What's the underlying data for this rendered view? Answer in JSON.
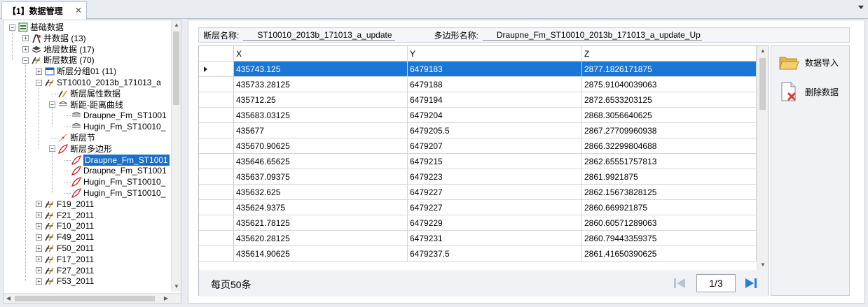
{
  "tab": {
    "title": "【1】数据管理",
    "close": "✕"
  },
  "tree": {
    "items": [
      {
        "label": "基础数据",
        "icon": "database-icon",
        "level": 0,
        "exp": "−"
      },
      {
        "label": "井数据 (13)",
        "icon": "well-icon",
        "level": 1,
        "exp": "+"
      },
      {
        "label": "地层数据 (17)",
        "icon": "layers-icon",
        "level": 1,
        "exp": "+"
      },
      {
        "label": "断层数据 (70)",
        "icon": "fault-icon",
        "level": 1,
        "exp": "−"
      },
      {
        "label": "断层分组01 (11)",
        "icon": "group-icon",
        "level": 2,
        "exp": "+"
      },
      {
        "label": "ST10010_2013b_171013_a",
        "icon": "fault-icon",
        "level": 2,
        "exp": "−"
      },
      {
        "label": "断层属性数据",
        "icon": "fault-attr-icon",
        "level": 3,
        "exp": ""
      },
      {
        "label": "断距-距离曲线",
        "icon": "curve-icon",
        "level": 3,
        "exp": "−"
      },
      {
        "label": "Draupne_Fm_ST1001",
        "icon": "curve-icon",
        "level": 4,
        "exp": ""
      },
      {
        "label": "Hugin_Fm_ST10010_",
        "icon": "curve-icon",
        "level": 4,
        "exp": ""
      },
      {
        "label": "断层节",
        "icon": "fault-node-icon",
        "level": 3,
        "exp": ""
      },
      {
        "label": "断层多边形",
        "icon": "polygon-icon",
        "level": 3,
        "exp": "−"
      },
      {
        "label": "Draupne_Fm_ST1001",
        "icon": "polygon-icon",
        "level": 4,
        "exp": "",
        "selected": true
      },
      {
        "label": "Draupne_Fm_ST1001",
        "icon": "polygon-icon",
        "level": 4,
        "exp": ""
      },
      {
        "label": "Hugin_Fm_ST10010_",
        "icon": "polygon-icon",
        "level": 4,
        "exp": ""
      },
      {
        "label": "Hugin_Fm_ST10010_",
        "icon": "polygon-icon",
        "level": 4,
        "exp": ""
      },
      {
        "label": "F19_2011",
        "icon": "fault-icon",
        "level": 2,
        "exp": "+"
      },
      {
        "label": "F21_2011",
        "icon": "fault-icon",
        "level": 2,
        "exp": "+"
      },
      {
        "label": "F10_2011",
        "icon": "fault-icon",
        "level": 2,
        "exp": "+"
      },
      {
        "label": "F49_2011",
        "icon": "fault-icon",
        "level": 2,
        "exp": "+"
      },
      {
        "label": "F50_2011",
        "icon": "fault-icon",
        "level": 2,
        "exp": "+"
      },
      {
        "label": "F17_2011",
        "icon": "fault-icon",
        "level": 2,
        "exp": "+"
      },
      {
        "label": "F27_2011",
        "icon": "fault-icon",
        "level": 2,
        "exp": "+"
      },
      {
        "label": "F53_2011",
        "icon": "fault-icon",
        "level": 2,
        "exp": "+"
      }
    ]
  },
  "info": {
    "fault_label": "断层名称:",
    "fault_value": "ST10010_2013b_171013_a_update",
    "polygon_label": "多边形名称:",
    "polygon_value": "Draupne_Fm_ST10010_2013b_171013_a_update_Up"
  },
  "grid": {
    "columns": [
      "X",
      "Y",
      "Z"
    ],
    "rows": [
      [
        "435743.125",
        "6479183",
        "2877.1826171875"
      ],
      [
        "435733.28125",
        "6479188",
        "2875.91040039063"
      ],
      [
        "435712.25",
        "6479194",
        "2872.6533203125"
      ],
      [
        "435683.03125",
        "6479204",
        "2868.3056640625"
      ],
      [
        "435677",
        "6479205.5",
        "2867.27709960938"
      ],
      [
        "435670.90625",
        "6479207",
        "2866.32299804688"
      ],
      [
        "435646.65625",
        "6479215",
        "2862.65551757813"
      ],
      [
        "435637.09375",
        "6479223",
        "2861.9921875"
      ],
      [
        "435632.625",
        "6479227",
        "2862.15673828125"
      ],
      [
        "435624.9375",
        "6479227",
        "2860.669921875"
      ],
      [
        "435621.78125",
        "6479229",
        "2860.60571289063"
      ],
      [
        "435620.28125",
        "6479231",
        "2860.79443359375"
      ],
      [
        "435614.90625",
        "6479237.5",
        "2861.41650390625"
      ]
    ],
    "selected_row": 0
  },
  "pager": {
    "per_page": "每页50条",
    "page": "1/3"
  },
  "actions": {
    "import_label": "数据导入",
    "delete_label": "删除数据"
  }
}
